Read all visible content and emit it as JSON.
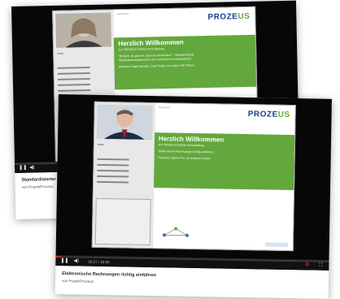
{
  "back_card": {
    "slide_header_left": "PROZEUS",
    "logo_main": "PROZE",
    "logo_accent": "US",
    "welcome_title": "Herzlich Willkommen",
    "welcome_subtitle": "zur PROZEUS Online-Veranstaltung",
    "line1": "\"Einfach, du ganzen, Sprache verwenden\" – Standardisierte",
    "line2": "Stammdatenaustausch in der modernen Konsumindustrie",
    "line3": "Referent: Katja Schoder, Cap Prinzip con Jaspe Lille Torque",
    "video_title": "Standardisierter",
    "channel": "von ProjektProzeus"
  },
  "front_card": {
    "slide_header_left": "PROZEUS",
    "logo_main": "PROZE",
    "logo_accent": "US",
    "welcome_title": "Herzlich Willkommen",
    "welcome_subtitle": "zur PROZEUS Online-Veranstaltung",
    "line1": "Elektronische Rechnungen richtig einführen",
    "line2": "Referent: Sabine Pro. dx research GmbH",
    "current_time": "00:27",
    "duration": "33:35",
    "progress": 0.02,
    "video_title": "Elektronische Rechnungen richtig einführen",
    "channel": "von ProjektProzeus"
  },
  "colors": {
    "slide_green": "#62a83d",
    "logo_blue": "#1a3f8a",
    "progress_red": "#d21f1f"
  },
  "icons": [
    "play-icon",
    "volume-icon",
    "settings-icon",
    "fullscreen-icon"
  ]
}
